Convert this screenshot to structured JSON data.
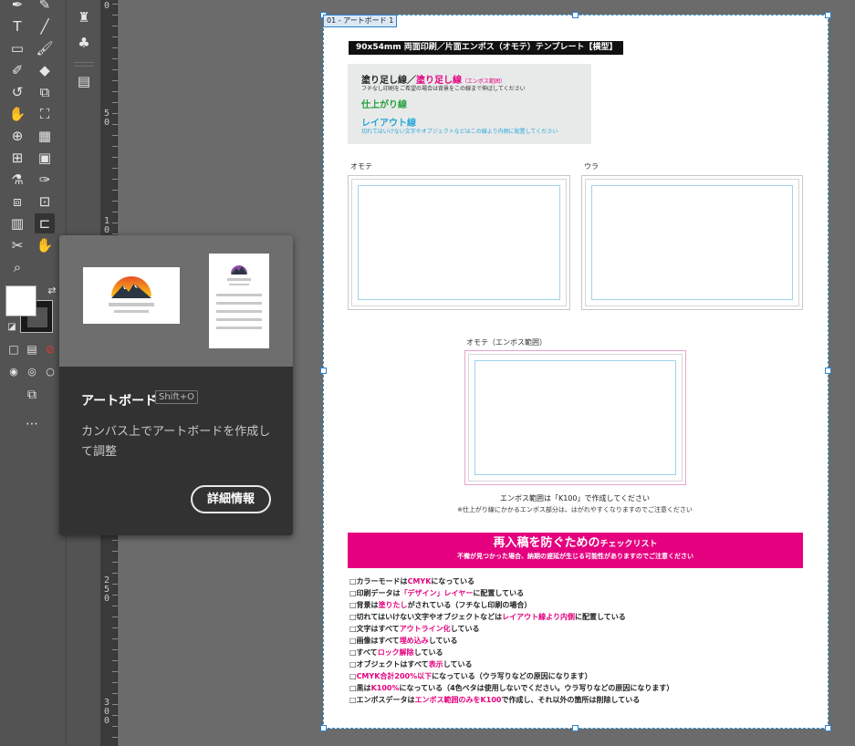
{
  "popup": {
    "title": "アートボード",
    "shortcut": "Shift+O",
    "description": "カンバス上でアートボードを作成して調整",
    "button": "詳細情報"
  },
  "ruler": {
    "labels": [
      "0",
      "5 0",
      "1 0",
      "2 5 0",
      "3 0 0"
    ]
  },
  "artboard": {
    "label": "01 - アートボード 1",
    "template_title": "90x54mm 両面印刷／片面エンボス（オモテ）テンプレート【横型】",
    "legend": {
      "bleed_a": "塗り足し線／",
      "bleed_b": "塗り足し線",
      "bleed_c": "（エンボス範囲）",
      "bleed_note": "フチなし印刷をご希望の場合は背景をこの線まで伸ばしてください",
      "trim": "仕上がり線",
      "layout": "レイアウト線",
      "layout_note": "切れてはいけない文字やオブジェクトなどはこの線より内側に配置してください"
    },
    "front_label": "オモテ",
    "back_label": "ウラ",
    "emboss_label": "オモテ（エンボス範囲）",
    "emboss_note1": "エンボス範囲は「K100」で作成してください",
    "emboss_note2": "※仕上がり線にかかるエンボス部分は、はがれやすくなりますのでご注意ください",
    "checklist_title_a": "再入稿を防ぐための",
    "checklist_title_b": "チェックリスト",
    "checklist_sub": "不備が見つかった場合、納期の遅延が生じる可能性がありますのでご注意ください",
    "checklist": [
      {
        "a": "□カラーモードは",
        "m": "CMYK",
        "b": "になっている"
      },
      {
        "a": "□印刷データは",
        "m": "「デザイン」レイヤー",
        "b": "に配置している"
      },
      {
        "a": "□背景は",
        "m": "塗りたし",
        "b": "がされている（フチなし印刷の場合）"
      },
      {
        "a": "□切れてはいけない文字やオブジェクトなどは",
        "m": "レイアウト線より内側",
        "b": "に配置している"
      },
      {
        "a": "□文字はすべて",
        "m": "アウトライン化",
        "b": "している"
      },
      {
        "a": "□画像はすべて",
        "m": "埋め込み",
        "b": "している"
      },
      {
        "a": "□すべて",
        "m": "ロック解除",
        "b": "している"
      },
      {
        "a": "□オブジェクトはすべて",
        "m": "表示",
        "b": "している"
      },
      {
        "a": "□",
        "m": "CMYK合計200%以下",
        "b": "になっている（ウラ写りなどの原因になります）"
      },
      {
        "a": "□黒は",
        "m": "K100%",
        "b": "になっている（4色ベタは使用しないでください。ウラ写りなどの原因になります）"
      },
      {
        "a": "□エンボスデータは",
        "m": "エンボス範囲のみをK100",
        "b": "で作成し、それ以外の箇所は削除している"
      }
    ]
  },
  "colors": {
    "magenta": "#e4007f",
    "green": "#22a03c",
    "blue": "#2aa6d8",
    "selection": "#2d9ad9"
  }
}
